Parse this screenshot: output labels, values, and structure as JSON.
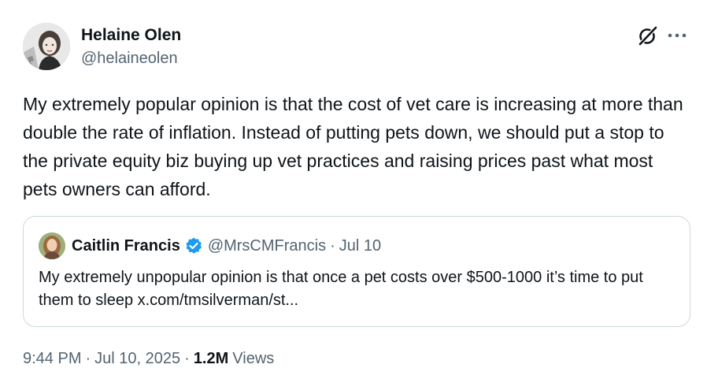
{
  "author": {
    "name": "Helaine Olen",
    "handle": "@helaineolen",
    "avatar_icon": "user-avatar"
  },
  "tweet": {
    "text": "My extremely popular opinion is that the cost of vet care is increasing at more than double the rate of inflation. Instead of putting pets down, we should put a stop to the private equity biz buying up vet practices and raising prices past what most pets owners can afford."
  },
  "icons": {
    "grok": "grok-icon",
    "more": "more-icon",
    "verified": "verified-badge-icon",
    "verified_color": "#1d9bf0"
  },
  "quote": {
    "name": "Caitlin Francis",
    "handle": "@MrsCMFrancis",
    "separator": "·",
    "date": "Jul 10",
    "text": "My extremely unpopular opinion is that once a pet costs over $500-1000 it’s time to put them to sleep x.com/tmsilverman/st..."
  },
  "meta": {
    "time": "9:44 PM",
    "separator": "·",
    "date": "Jul 10, 2025",
    "views_count": "1.2M",
    "views_label": "Views"
  },
  "colors": {
    "text_primary": "#0f1419",
    "text_secondary": "#536471",
    "border": "#cfd9de"
  }
}
